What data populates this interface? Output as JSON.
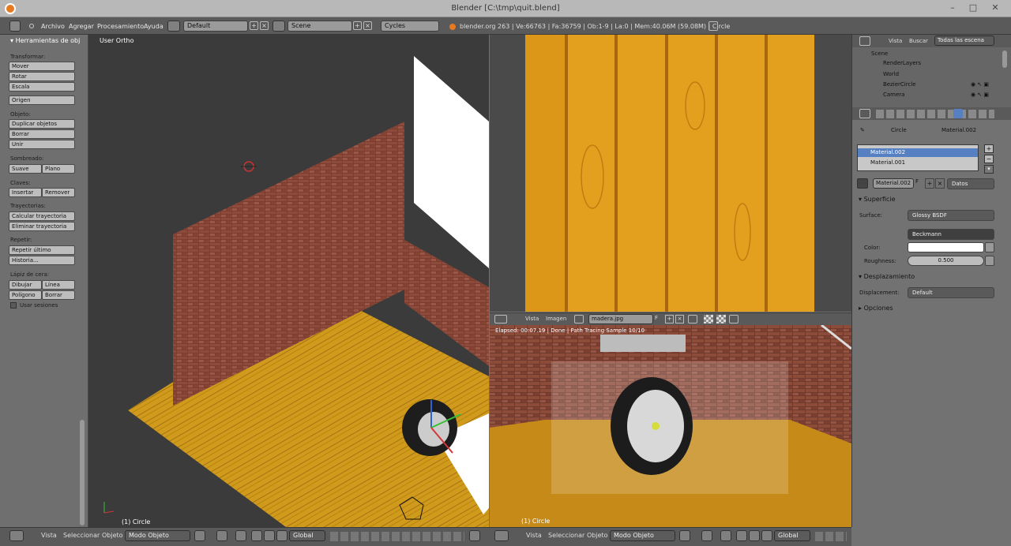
{
  "titlebar": {
    "title": "Blender [C:\\tmp\\quit.blend]",
    "minimize": "–",
    "maximize": "□",
    "close": "✕"
  },
  "infobar": {
    "menus": [
      "Archivo",
      "Agregar",
      "Procesamiento",
      "Ayuda"
    ],
    "screen": "Default",
    "scene": "Scene",
    "engine": "Cycles",
    "stats": "blender.org 263 | Ve:66763 | Fa:36759 | Ob:1-9 | La:0 | Mem:40.06M (59.08M) | Circle"
  },
  "toolshelf": {
    "header": "Herramientas de obj",
    "sections": {
      "transform": "Transformar:",
      "object": "Objeto:",
      "shading": "Sombreado:",
      "keys": "Claves:",
      "paths": "Trayectorias:",
      "repeat": "Repetir:",
      "grease": "Lápiz de cera:"
    },
    "buttons": {
      "move": "Mover",
      "rotate": "Rotar",
      "scale": "Escala",
      "origin": "Origen",
      "duplicate": "Duplicar objetos",
      "delete": "Borrar",
      "join": "Unir",
      "smooth": "Suave",
      "flat": "Plano",
      "insert": "Insertar",
      "remove": "Remover",
      "calc_path": "Calcular trayectoria",
      "clear_path": "Eliminar trayectoria",
      "repeat_last": "Repetir último",
      "history": "Historia...",
      "draw": "Dibujar",
      "line": "Línea",
      "poly": "Polígono",
      "erase": "Borrar"
    },
    "use_sessions": "Usar sesiones"
  },
  "viewport3d": {
    "view_label": "User Ortho",
    "object_label": "(1) Circle"
  },
  "render": {
    "status": "Elapsed: 00:07.19 | Done | Path Tracing Sample 10/10",
    "object_label": "(1) Circle"
  },
  "image_editor": {
    "menus": [
      "Vista",
      "Imagen"
    ],
    "image": "madera.jpg",
    "fake": "F"
  },
  "bottom_left": {
    "menus": [
      "Vista",
      "Seleccionar",
      "Objeto"
    ],
    "mode": "Modo Objeto",
    "orientation": "Global"
  },
  "bottom_right": {
    "menus": [
      "Vista",
      "Seleccionar",
      "Objeto"
    ],
    "mode": "Modo Objeto",
    "orientation": "Global"
  },
  "outliner": {
    "view": "Vista",
    "search": "Buscar",
    "filter": "Todas las escena",
    "items": [
      "Scene",
      "RenderLayers",
      "World",
      "BezierCircle",
      "Camera"
    ]
  },
  "properties": {
    "breadcrumb": [
      "Circle",
      "Material.002"
    ],
    "materials": [
      "Material.002",
      "Material.001"
    ],
    "material_name": "Material.002",
    "fake": "F",
    "data": "Datos",
    "surface_panel": "Superficie",
    "surface_label": "Surface:",
    "surface_value": "Glossy BSDF",
    "distribution": "Beckmann",
    "color_label": "Color:",
    "roughness_label": "Roughness:",
    "roughness_value": "0.500",
    "displacement_panel": "Desplazamiento",
    "displacement_label": "Displacement:",
    "displacement_value": "Default",
    "options_panel": "Opciones"
  },
  "colors": {
    "wood": "#e0a020",
    "brick": "#8a4c3c",
    "accent": "#5680c2"
  }
}
